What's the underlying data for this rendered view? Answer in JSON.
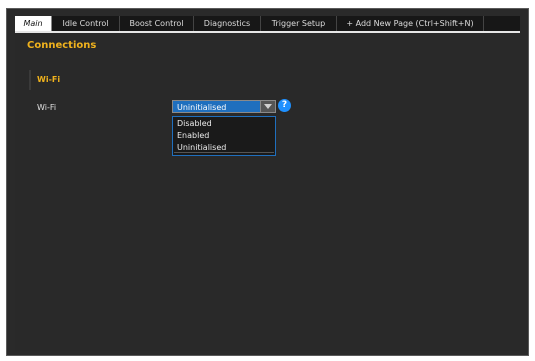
{
  "tabs": [
    {
      "label": "Main"
    },
    {
      "label": "Idle Control"
    },
    {
      "label": "Boost Control"
    },
    {
      "label": "Diagnostics"
    },
    {
      "label": "Trigger Setup"
    },
    {
      "label": "+ Add New Page (Ctrl+Shift+N)"
    }
  ],
  "page": {
    "title": "Connections",
    "section_title": "Wi-Fi",
    "field_label": "Wi-Fi",
    "select_value": "Uninitialised",
    "help_symbol": "?",
    "options": [
      "Disabled",
      "Enabled",
      "Uninitialised"
    ]
  },
  "icons": {
    "dropdown_arrow": "chevron-down-icon",
    "help": "help-icon"
  },
  "colors": {
    "accent": "#f0b21d",
    "selection": "#1f6fbe",
    "help": "#1e90ff",
    "background": "#292929"
  }
}
